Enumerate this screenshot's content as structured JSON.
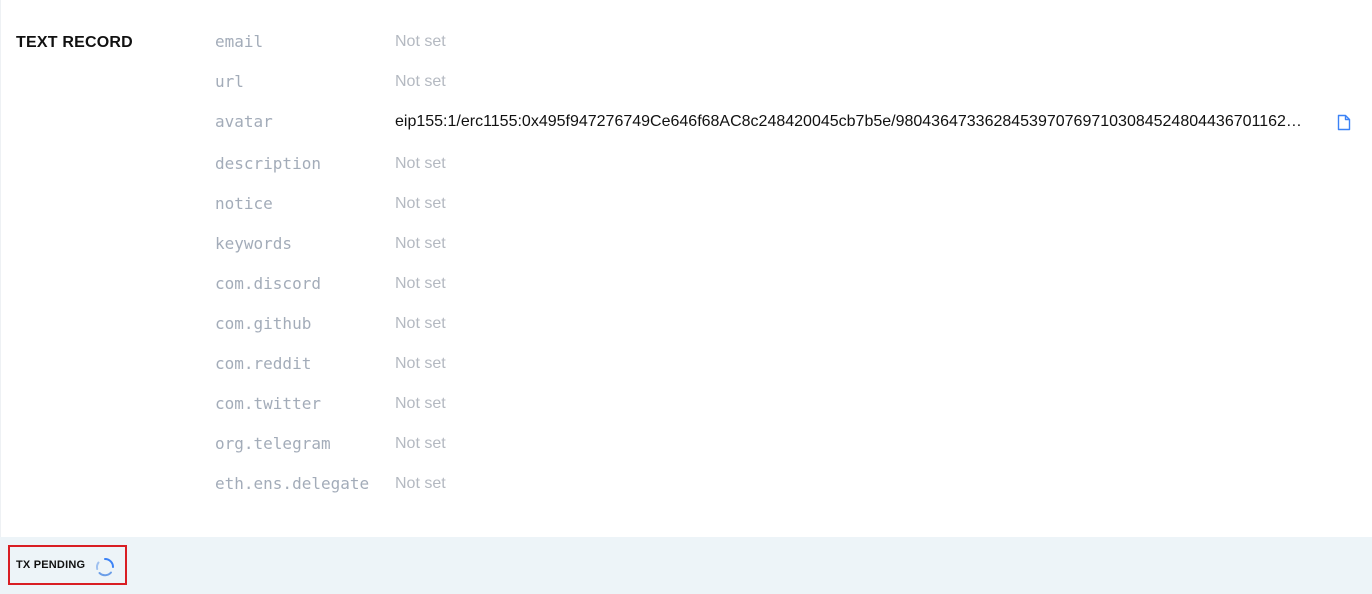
{
  "section": {
    "title": "TEXT RECORD"
  },
  "records": [
    {
      "key": "email",
      "value": "Not set",
      "set": false
    },
    {
      "key": "url",
      "value": "Not set",
      "set": false
    },
    {
      "key": "avatar",
      "value": "eip155:1/erc1155:0x495f947276749Ce646f68AC8c248420045cb7b5e/98043647336284539707697103084524804436701162…",
      "set": true
    },
    {
      "key": "description",
      "value": "Not set",
      "set": false
    },
    {
      "key": "notice",
      "value": "Not set",
      "set": false
    },
    {
      "key": "keywords",
      "value": "Not set",
      "set": false
    },
    {
      "key": "com.discord",
      "value": "Not set",
      "set": false
    },
    {
      "key": "com.github",
      "value": "Not set",
      "set": false
    },
    {
      "key": "com.reddit",
      "value": "Not set",
      "set": false
    },
    {
      "key": "com.twitter",
      "value": "Not set",
      "set": false
    },
    {
      "key": "org.telegram",
      "value": "Not set",
      "set": false
    },
    {
      "key": "eth.ens.delegate",
      "value": "Not set",
      "set": false
    }
  ],
  "icons": {
    "copy": "copy-icon",
    "spinner": "loading-spinner-icon"
  },
  "footer": {
    "status": "TX PENDING"
  },
  "colors": {
    "accent": "#3b82f6",
    "highlight_border": "#d91e23",
    "footer_bg": "#edf4f8",
    "muted_key": "#a3acb9",
    "muted_value": "#b4b9c1"
  }
}
